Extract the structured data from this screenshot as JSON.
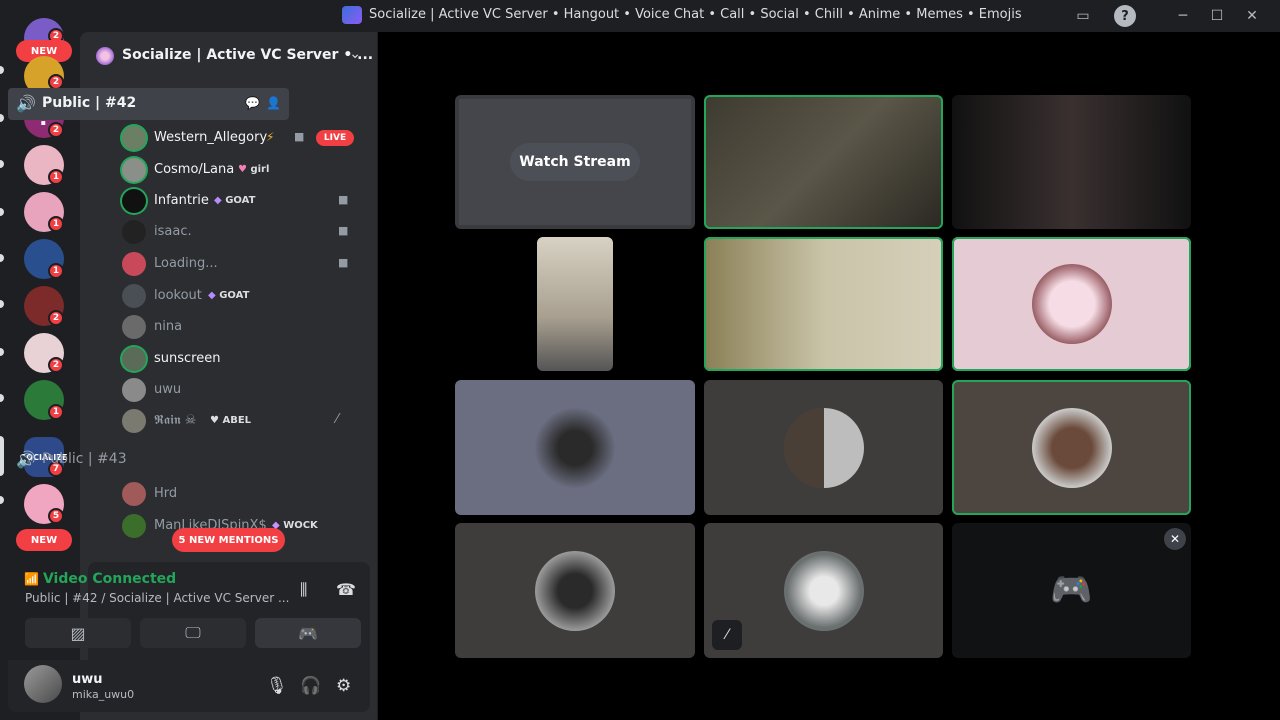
{
  "window": {
    "title": "Socialize | Active VC Server • Hangout • Voice Chat • Call • Social • Chill • Anime • Memes • Emojis",
    "controls": [
      "inbox-icon",
      "help-icon",
      "minimize-icon",
      "maximize-icon",
      "close-icon"
    ]
  },
  "rail": {
    "new_top": "NEW",
    "new_bottom": "NEW",
    "servers": [
      {
        "badge": "2"
      },
      {
        "badge": "2"
      },
      {
        "badge": "2"
      },
      {
        "badge": "1"
      },
      {
        "badge": "1"
      },
      {
        "badge": "1"
      },
      {
        "badge": "2"
      },
      {
        "badge": "2"
      },
      {
        "badge": "1"
      },
      {
        "badge": "7",
        "label": "SOCIALIZE"
      },
      {
        "badge": "5"
      }
    ]
  },
  "sidebar": {
    "server_name": "Socialize | Active VC Server • ...",
    "channels": [
      {
        "name": "Public | #42",
        "members": [
          {
            "name": "Western_Allegory",
            "extra": "⚡",
            "live": "LIVE"
          },
          {
            "name": "Cosmo/Lana",
            "tag": "girl"
          },
          {
            "name": "Infantrie",
            "tag": "GOAT"
          },
          {
            "name": "isaac."
          },
          {
            "name": "Loading..."
          },
          {
            "name": "lookout",
            "tag": "GOAT"
          },
          {
            "name": "nina"
          },
          {
            "name": "sunscreen"
          },
          {
            "name": "uwu"
          },
          {
            "name": "𝕽𝖆𝖎𝖓 ☠",
            "tag": "ABEL"
          }
        ]
      },
      {
        "name": "Public | #43",
        "members": [
          {
            "name": "Hrd"
          },
          {
            "name": "ManLikeDJSpinX$",
            "tag": "WOCK"
          }
        ]
      }
    ],
    "new_mentions": "5 NEW MENTIONS"
  },
  "voice": {
    "status": "Video Connected",
    "channel_line": "Public | #42 / Socialize | Active VC Server ..."
  },
  "user": {
    "name": "uwu",
    "handle": "mika_uwu0"
  },
  "stage": {
    "watch_stream": "Watch Stream"
  },
  "colors": {
    "speaking": "#23a55a",
    "danger": "#f23f43",
    "sidebar": "#2b2d31",
    "rail": "#1e1f22"
  }
}
